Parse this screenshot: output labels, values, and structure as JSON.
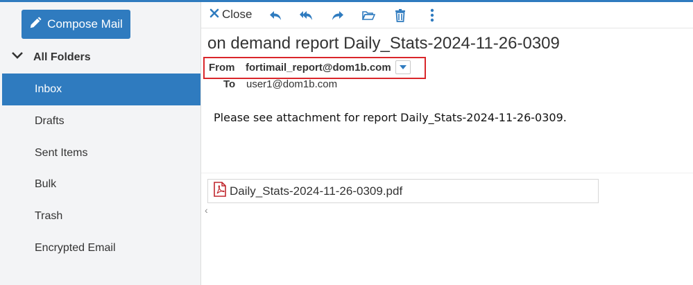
{
  "sidebar": {
    "compose_label": "Compose Mail",
    "folders_header": "All Folders",
    "folders": [
      {
        "label": "Inbox",
        "active": true
      },
      {
        "label": "Drafts",
        "active": false
      },
      {
        "label": "Sent Items",
        "active": false
      },
      {
        "label": "Bulk",
        "active": false
      },
      {
        "label": "Trash",
        "active": false
      },
      {
        "label": "Encrypted Email",
        "active": false
      }
    ]
  },
  "toolbar": {
    "close_label": "Close",
    "icons": [
      "close-icon",
      "reply-icon",
      "reply-all-icon",
      "forward-icon",
      "move-folder-icon",
      "delete-icon",
      "more-options-icon"
    ]
  },
  "message": {
    "subject": "on demand report Daily_Stats-2024-11-26-0309",
    "from_label": "From",
    "from_value": "fortimail_report@dom1b.com",
    "to_label": "To",
    "to_value": "user1@dom1b.com",
    "body": "Please see attachment for report Daily_Stats-2024-11-26-0309.",
    "attachment_name": "Daily_Stats-2024-11-26-0309.pdf"
  },
  "colors": {
    "accent": "#2f7bbf",
    "highlight_border": "#d9262a",
    "pdf_red": "#c0262d"
  }
}
